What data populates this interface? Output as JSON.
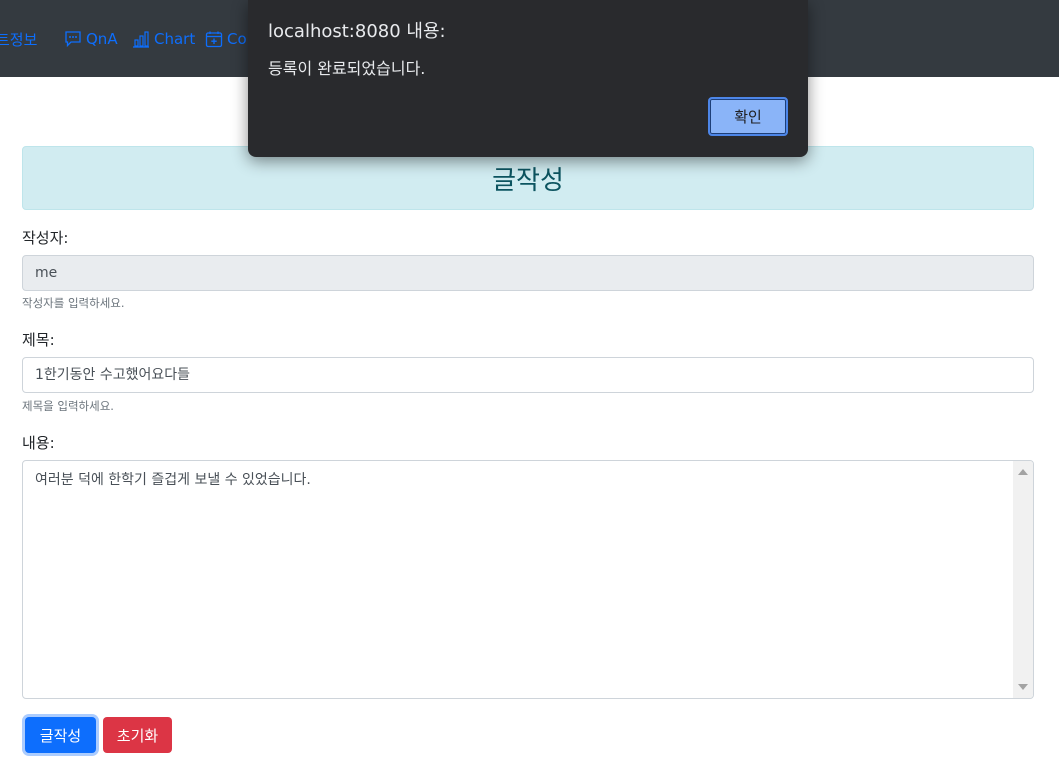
{
  "nav": {
    "items": [
      {
        "label": "트정보",
        "icon": "none"
      },
      {
        "label": "QnA",
        "icon": "chat-icon"
      },
      {
        "label": "Chart",
        "icon": "bar-chart-icon"
      },
      {
        "label": "Co",
        "icon": "calendar-plus-icon"
      }
    ]
  },
  "header": {
    "title": "글작성"
  },
  "form": {
    "writer": {
      "label": "작성자:",
      "value": "me",
      "help": "작성자를 입력하세요."
    },
    "subject": {
      "label": "제목:",
      "value": "1한기동안 수고했어요다들",
      "help": "제목을 입력하세요."
    },
    "content": {
      "label": "내용:",
      "value": "여러분 덕에 한학기 즐겁게 보낼 수 있었습니다."
    }
  },
  "buttons": {
    "submit": "글작성",
    "reset": "초기화"
  },
  "dialog": {
    "title": "localhost:8080 내용:",
    "message": "등록이 완료되었습니다.",
    "ok": "확인"
  },
  "colors": {
    "navbar": "#343a40",
    "link": "#0d6efd",
    "info_bg": "#d1ecf1",
    "info_text": "#0c5460",
    "primary": "#0d6efd",
    "danger": "#dc3545",
    "dialog_bg": "#292a2d",
    "dialog_button": "#8ab4f8"
  }
}
